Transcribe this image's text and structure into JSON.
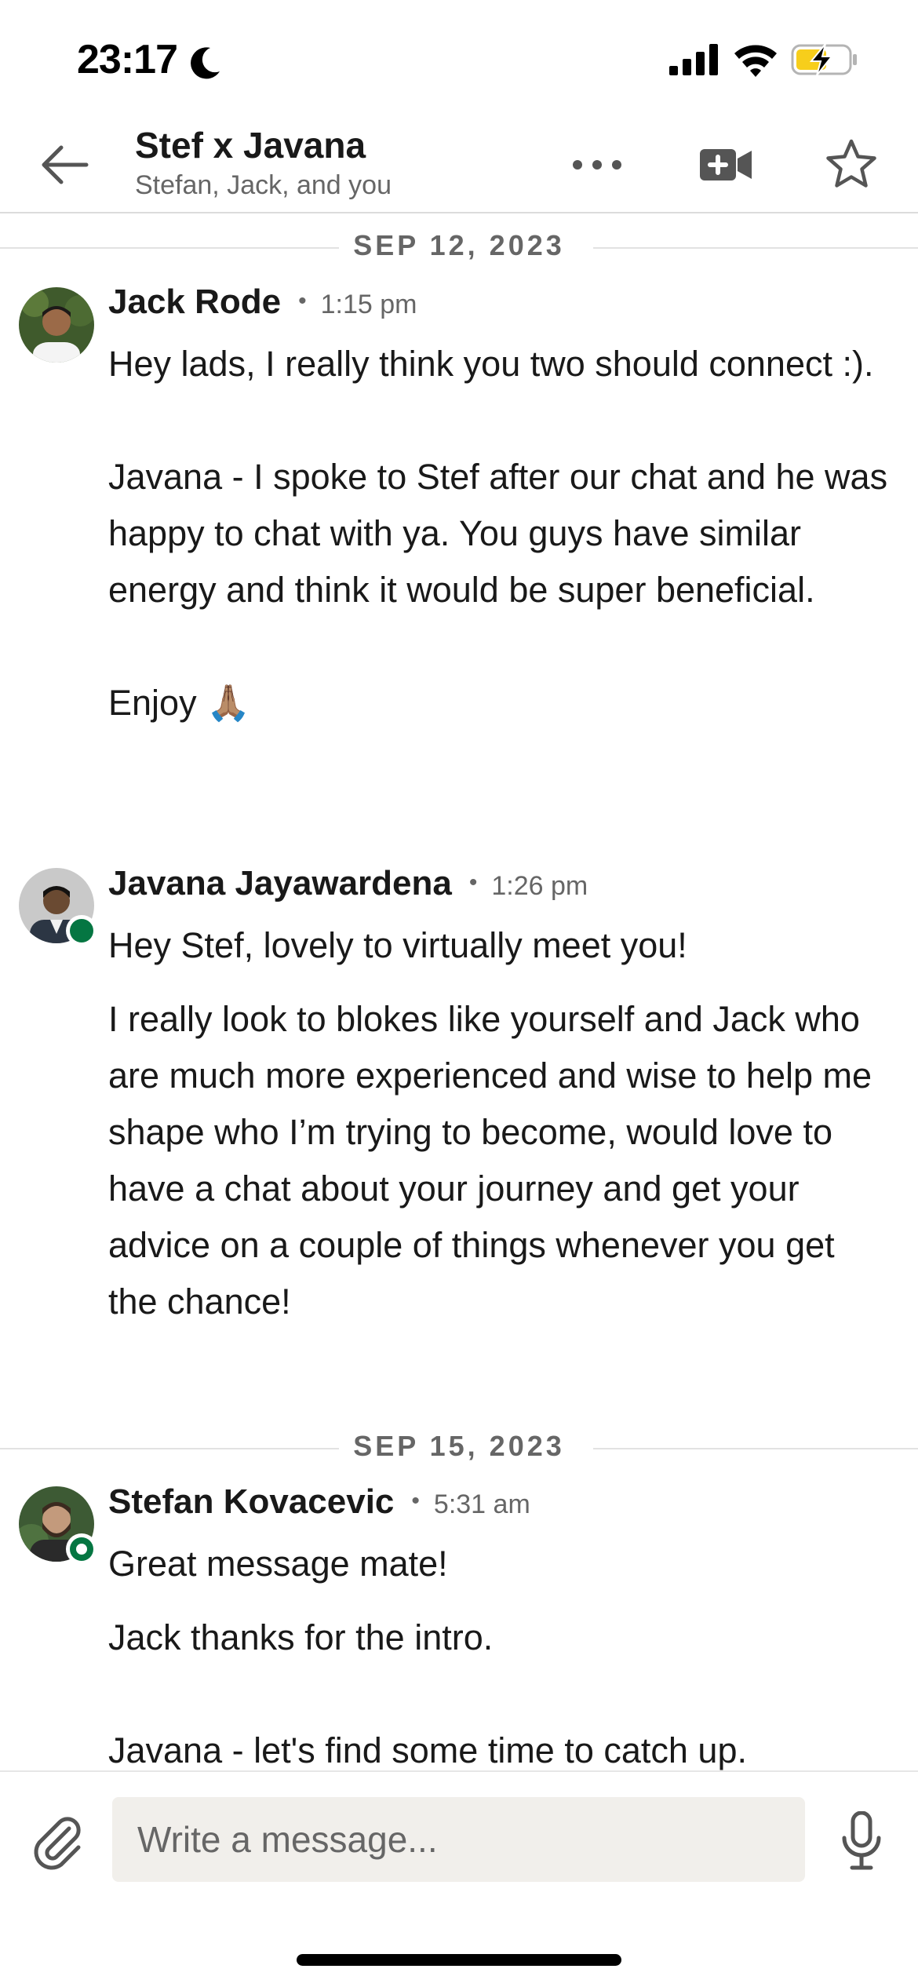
{
  "status_bar": {
    "time": "23:17",
    "icons": [
      "moon-icon",
      "signal-icon",
      "wifi-icon",
      "battery-charging-icon"
    ]
  },
  "header": {
    "title": "Stef x Javana",
    "subtitle": "Stefan, Jack, and you",
    "icons": [
      "back-arrow-icon",
      "more-icon",
      "video-call-icon",
      "star-icon"
    ]
  },
  "conversation": {
    "dates": [
      "SEP 12, 2023",
      "SEP 15, 2023"
    ],
    "messages": [
      {
        "sender": "Jack Rode",
        "time": "1:15 pm",
        "online": false,
        "paragraphs": [
          "Hey lads, I really think you two should connect :).\n\nJavana - I spoke to Stef after our chat and he was happy to chat with ya. You guys have similar energy and think it would be super beneficial.\n\nEnjoy 🙏🏽"
        ]
      },
      {
        "sender": "Javana Jayawardena",
        "time": "1:26 pm",
        "online": true,
        "paragraphs": [
          "Hey Stef, lovely to virtually meet you!",
          "I really look to blokes like yourself and Jack who are much more experienced and wise to help me shape who I’m trying to become, would love to have a chat about your journey and get your advice on a couple of things whenever you get the chance!"
        ]
      },
      {
        "sender": "Stefan Kovacevic",
        "time": "5:31 am",
        "online": true,
        "paragraphs": [
          "Great message mate!",
          "Jack thanks for the intro.\n\nJavana - let's find some time to catch up."
        ]
      }
    ]
  },
  "composer": {
    "placeholder": "Write a message...",
    "icons": [
      "paperclip-icon",
      "microphone-icon"
    ]
  },
  "colors": {
    "presence_green": "#057642",
    "text_primary": "#191919",
    "text_secondary": "#666666",
    "input_background": "#f1efeb"
  }
}
